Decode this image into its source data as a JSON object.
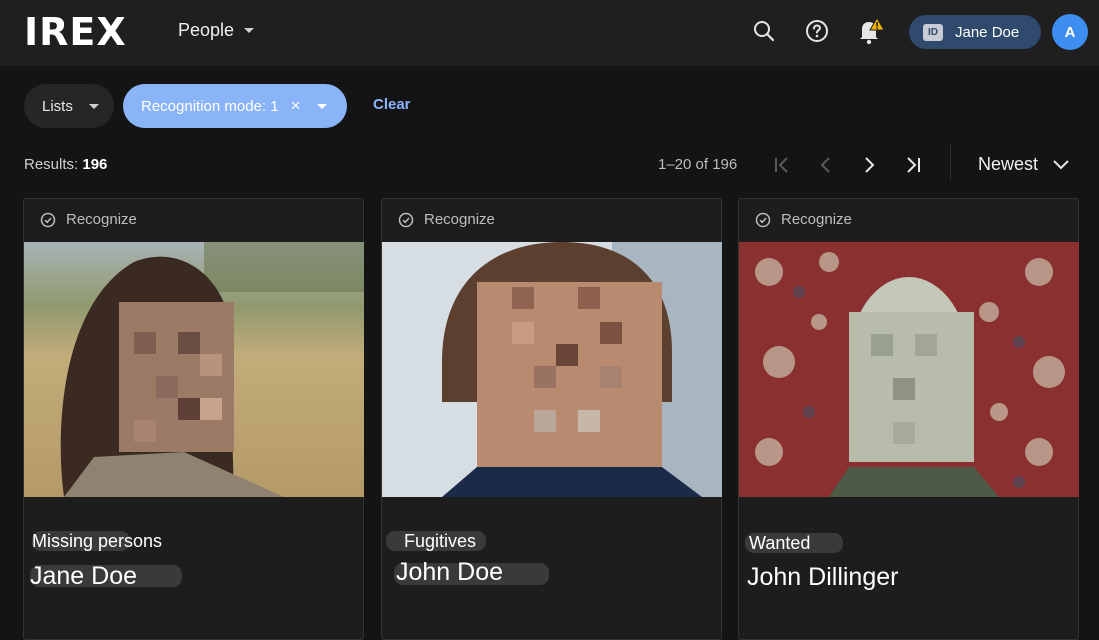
{
  "app": {
    "logo": "IREX",
    "nav_label": "People"
  },
  "header": {
    "user_name": "Jane Doe",
    "id_badge": "ID",
    "avatar_letter": "A",
    "alert_color": "#f2b400"
  },
  "filters": {
    "lists_label": "Lists",
    "recognition_label": "Recognition mode: 1",
    "recognition_close": "×",
    "clear_label": "Clear"
  },
  "results": {
    "label": "Results:",
    "count": "196",
    "range": "1–20 of 196",
    "sort_label": "Newest"
  },
  "cards": [
    {
      "recognize_label": "Recognize",
      "list": "Missing persons",
      "name": "Jane Doe"
    },
    {
      "recognize_label": "Recognize",
      "list": "Fugitives",
      "name": "John Doe"
    },
    {
      "recognize_label": "Recognize",
      "list": "Wanted",
      "name": "John Dillinger"
    }
  ],
  "colors": {
    "accent": "#8ab4f8",
    "avatar": "#3d8ef0",
    "user_chip": "#2f4a6d"
  }
}
